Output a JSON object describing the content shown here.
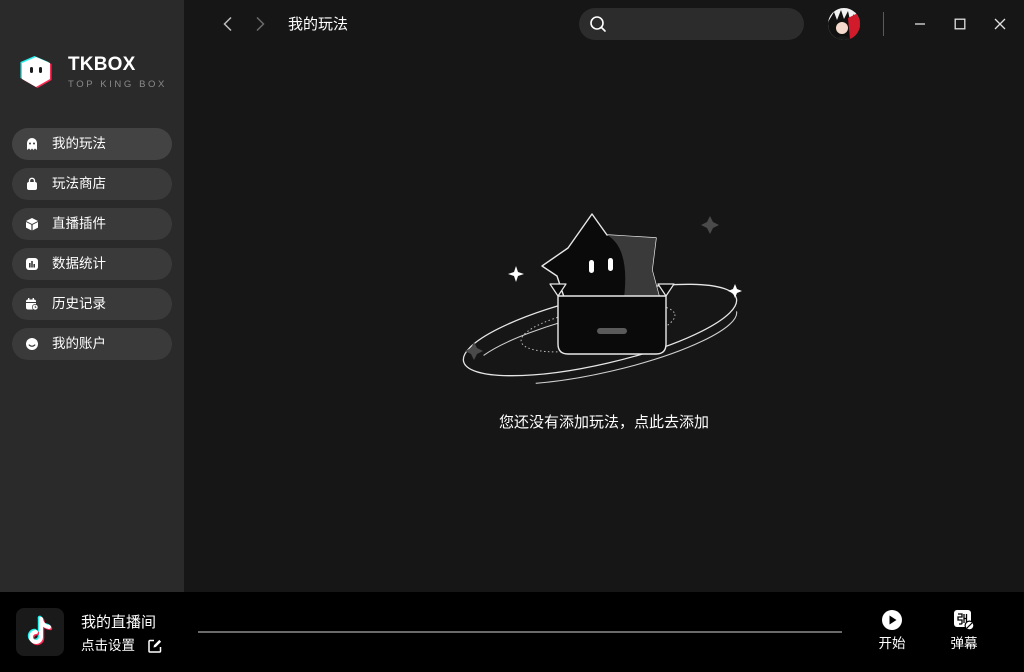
{
  "brand": {
    "name": "TKBOX",
    "subtitle": "TOP KING BOX"
  },
  "sidebar": {
    "items": [
      {
        "label": "我的玩法",
        "icon": "ghost-icon",
        "active": true
      },
      {
        "label": "玩法商店",
        "icon": "shopping-bag-icon",
        "active": false
      },
      {
        "label": "直播插件",
        "icon": "cube-icon",
        "active": false
      },
      {
        "label": "数据统计",
        "icon": "bar-chart-icon",
        "active": false
      },
      {
        "label": "历史记录",
        "icon": "calendar-clock-icon",
        "active": false
      },
      {
        "label": "我的账户",
        "icon": "smiley-icon",
        "active": false
      }
    ]
  },
  "header": {
    "title": "我的玩法",
    "back_icon": "chevron-left-icon",
    "forward_icon": "chevron-right-icon",
    "search": {
      "value": "",
      "placeholder": "",
      "icon": "search-icon"
    },
    "window_controls": [
      "minimize-icon",
      "maximize-icon",
      "close-icon"
    ]
  },
  "main": {
    "empty_message": "您还没有添加玩法，点此去添加"
  },
  "footer": {
    "room_name": "我的直播间",
    "setting_label": "点击设置",
    "progress": 1.0,
    "actions": [
      {
        "label": "开始",
        "icon": "play-icon"
      },
      {
        "label": "弹幕",
        "icon": "danmaku-icon"
      }
    ]
  },
  "colors": {
    "sidebar_bg": "#2a2a2a",
    "main_bg": "#161616",
    "bottom_bg": "#000000",
    "nav_item_bg": "#3a3a3a",
    "text": "#ffffff",
    "brand_cyan": "#25f4ee",
    "brand_red": "#fe2c55"
  }
}
